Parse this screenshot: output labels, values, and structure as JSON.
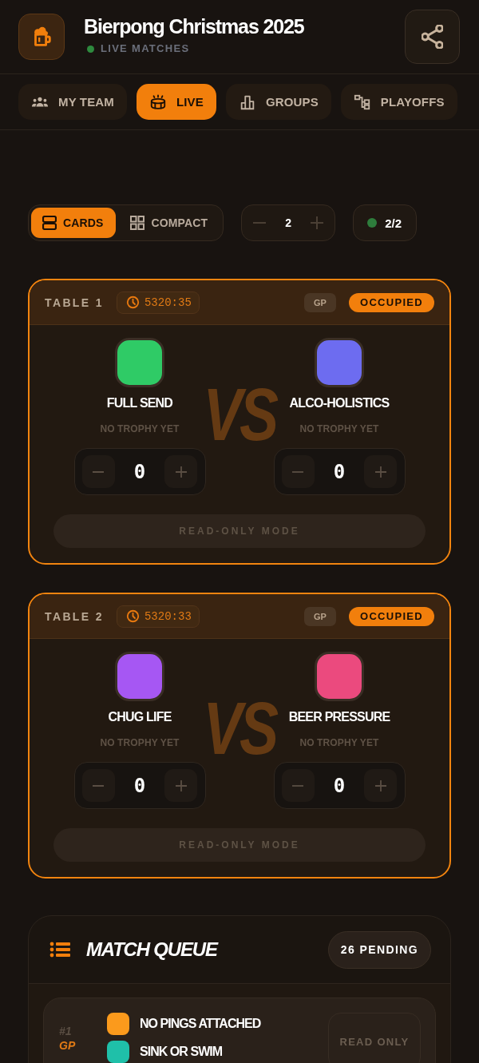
{
  "header": {
    "title": "Bierpong Christmas 2025",
    "subtitle": "LIVE MATCHES"
  },
  "tabs": [
    {
      "label": "MY TEAM",
      "selected": false
    },
    {
      "label": "LIVE",
      "selected": true
    },
    {
      "label": "GROUPS",
      "selected": false
    },
    {
      "label": "PLAYOFFS",
      "selected": false
    }
  ],
  "view_modes": [
    {
      "label": "CARDS",
      "selected": true
    },
    {
      "label": "COMPACT",
      "selected": false
    }
  ],
  "table_count": {
    "value": "2"
  },
  "active_tables": {
    "value": "2/2"
  },
  "tables": [
    {
      "title": "TABLE 1",
      "timer": "5320:35",
      "round": "GP",
      "status": "OCCUPIED",
      "teams": [
        {
          "name": "FULL SEND",
          "color": "#2fcb66",
          "trophy": "NO TROPHY YET",
          "score": "0"
        },
        {
          "name": "ALCO-HOLISTICS",
          "color": "#6d6cf0",
          "trophy": "NO TROPHY YET",
          "score": "0"
        }
      ],
      "versus": "VS",
      "mode": "READ-ONLY MODE"
    },
    {
      "title": "TABLE 2",
      "timer": "5320:33",
      "round": "GP",
      "status": "OCCUPIED",
      "teams": [
        {
          "name": "CHUG LIFE",
          "color": "#a657f3",
          "trophy": "NO TROPHY YET",
          "score": "0"
        },
        {
          "name": "BEER PRESSURE",
          "color": "#eb4a7e",
          "trophy": "NO TROPHY YET",
          "score": "0"
        }
      ],
      "versus": "VS",
      "mode": "READ-ONLY MODE"
    }
  ],
  "match_queue": {
    "title": "MATCH QUEUE",
    "pending": "26 PENDING",
    "matches": [
      {
        "number": "#1",
        "round": "GP",
        "teams": [
          {
            "name": "NO PINGS ATTACHED",
            "color": "#fb9a1c"
          },
          {
            "name": "SINK OR SWIM",
            "color": "#1fc0a9"
          }
        ],
        "action": "READ ONLY"
      }
    ]
  }
}
